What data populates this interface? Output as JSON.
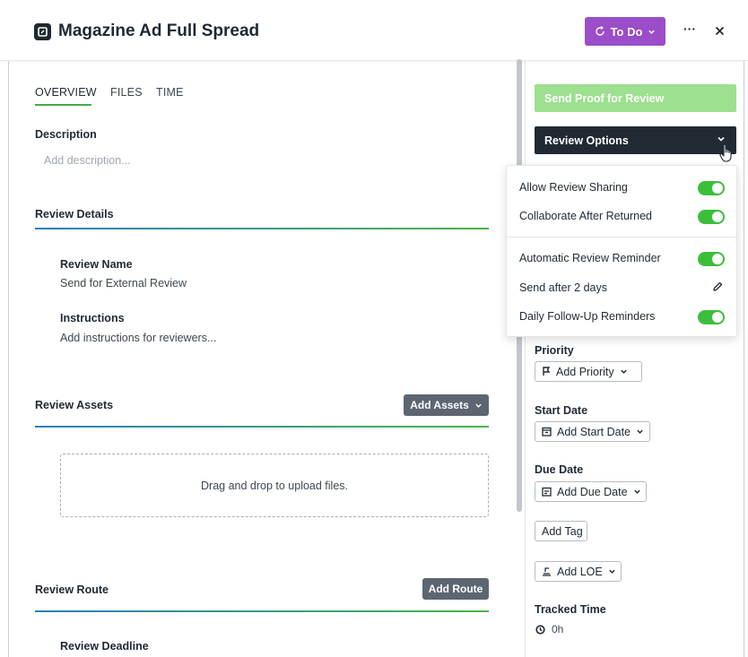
{
  "header": {
    "title": "Magazine Ad Full Spread",
    "status_label": "To Do",
    "more_label": "···"
  },
  "tabs": [
    {
      "label": "OVERVIEW",
      "active": true
    },
    {
      "label": "FILES",
      "active": false
    },
    {
      "label": "TIME",
      "active": false
    }
  ],
  "description": {
    "label": "Description",
    "placeholder": "Add description..."
  },
  "review_details": {
    "heading": "Review Details",
    "name_label": "Review Name",
    "name_value": "Send for External Review",
    "instructions_label": "Instructions",
    "instructions_placeholder": "Add instructions for reviewers..."
  },
  "review_assets": {
    "heading": "Review Assets",
    "add_button": "Add Assets",
    "dropzone_text": "Drag and drop to upload files."
  },
  "review_route": {
    "heading": "Review Route",
    "add_button": "Add Route",
    "deadline_label": "Review Deadline"
  },
  "right_panel": {
    "send_proof_label": "Send Proof for Review",
    "review_options_label": "Review Options",
    "options": [
      {
        "label": "Allow Review Sharing",
        "control": "toggle",
        "on": true
      },
      {
        "label": "Collaborate After Returned",
        "control": "toggle",
        "on": true
      },
      {
        "label": "Automatic Review Reminder",
        "control": "toggle",
        "on": true
      },
      {
        "label": "Send after 2 days",
        "control": "edit"
      },
      {
        "label": "Daily Follow-Up Reminders",
        "control": "toggle",
        "on": true
      }
    ],
    "priority_label": "Priority",
    "priority_button": "Add Priority",
    "start_label": "Start Date",
    "start_button": "Add Start Date",
    "due_label": "Due Date",
    "due_button": "Add Due Date",
    "tag_button": "Add Tag",
    "loe_button": "Add LOE",
    "tracked_label": "Tracked Time",
    "tracked_value": "0h"
  },
  "colors": {
    "status": "#9b4dca",
    "send_proof": "#9de08f",
    "review_options": "#1f2a33",
    "toggle_on": "#3bbf3b",
    "tab_active": "#3fae49"
  }
}
